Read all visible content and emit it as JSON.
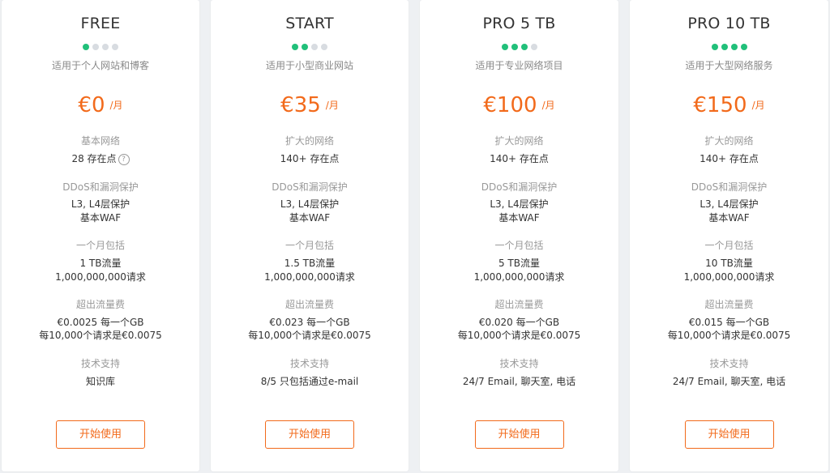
{
  "plans": [
    {
      "name": "FREE",
      "level": 1,
      "subtitle": "适用于个人网站和博客",
      "price": "€0",
      "unit": "/月",
      "network_title": "基本网络",
      "network_value": "28 存在点",
      "network_help": "?",
      "ddos_title": "DDoS和漏洞保护",
      "ddos_line1": "L3, L4层保护",
      "ddos_line2": "基本WAF",
      "monthly_title": "一个月包括",
      "monthly_line1": "1 TB流量",
      "monthly_line2": "1,000,000,000请求",
      "overage_title": "超出流量费",
      "overage_line1": "€0.0025 每一个GB",
      "overage_line2": "每10,000个请求是€0.0075",
      "support_title": "技术支持",
      "support_value": "知识库",
      "button": "开始使用"
    },
    {
      "name": "START",
      "level": 2,
      "subtitle": "适用于小型商业网站",
      "price": "€35",
      "unit": "/月",
      "network_title": "扩大的网络",
      "network_value": "140+ 存在点",
      "ddos_title": "DDoS和漏洞保护",
      "ddos_line1": "L3, L4层保护",
      "ddos_line2": "基本WAF",
      "monthly_title": "一个月包括",
      "monthly_line1": "1.5 TB流量",
      "monthly_line2": "1,000,000,000请求",
      "overage_title": "超出流量费",
      "overage_line1": "€0.023 每一个GB",
      "overage_line2": "每10,000个请求是€0.0075",
      "support_title": "技术支持",
      "support_value": "8/5 只包括通过e-mail",
      "button": "开始使用"
    },
    {
      "name": "PRO 5 TB",
      "level": 3,
      "subtitle": "适用于专业网络项目",
      "price": "€100",
      "unit": "/月",
      "network_title": "扩大的网络",
      "network_value": "140+ 存在点",
      "ddos_title": "DDoS和漏洞保护",
      "ddos_line1": "L3, L4层保护",
      "ddos_line2": "基本WAF",
      "monthly_title": "一个月包括",
      "monthly_line1": "5 TB流量",
      "monthly_line2": "1,000,000,000请求",
      "overage_title": "超出流量费",
      "overage_line1": "€0.020 每一个GB",
      "overage_line2": "每10,000个请求是€0.0075",
      "support_title": "技术支持",
      "support_value": "24/7 Email, 聊天室, 电话",
      "button": "开始使用"
    },
    {
      "name": "PRO 10 TB",
      "level": 4,
      "subtitle": "适用于大型网络服务",
      "price": "€150",
      "unit": "/月",
      "network_title": "扩大的网络",
      "network_value": "140+ 存在点",
      "ddos_title": "DDoS和漏洞保护",
      "ddos_line1": "L3, L4层保护",
      "ddos_line2": "基本WAF",
      "monthly_title": "一个月包括",
      "monthly_line1": "10 TB流量",
      "monthly_line2": "1,000,000,000请求",
      "overage_title": "超出流量费",
      "overage_line1": "€0.015 每一个GB",
      "overage_line2": "每10,000个请求是€0.0075",
      "support_title": "技术支持",
      "support_value": "24/7 Email, 聊天室, 电话",
      "button": "开始使用"
    }
  ],
  "colors": {
    "accent": "#f26a1b",
    "dot_active": "#21c07a",
    "dot_inactive": "#d8dce1"
  }
}
